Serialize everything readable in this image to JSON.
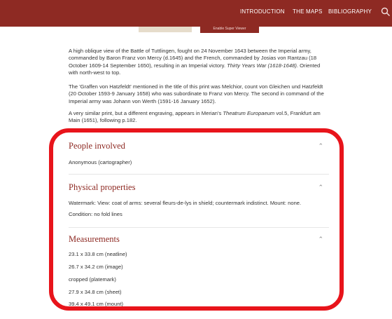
{
  "nav": {
    "introduction": "INTRODUCTION",
    "the_maps": "THE MAPS",
    "bibliography": "BIBLIOGRAPHY"
  },
  "fragments": {
    "button_text": "Enable Super Viewer"
  },
  "description": {
    "p1_before": "A high oblique view of the Battle of Tuttlingen, fought on 24 November 1643 between the Imperial army, commanded by Baron Franz von Mercy (d.1645) and the French, commanded by Josias von Rantzau (18 October 1609-14 September 1650), resulting in an Imperial victory. ",
    "p1_italic": "Thirty Years War (1618-1648)",
    "p1_after": ". Oriented with north-west to top.",
    "p2": "The 'Graffen von Hatzfeldt' mentioned in the title of this print was Melchior, count von Gleichen und Hatzfeldt (20 October 1593-9 January 1658) who was subordinate to Franz von Mercy. The second in command of the Imperial army was Johann von Werth (1591-16 January 1652).",
    "p3_before": "A very similar print, but a different engraving, appears in Merian's ",
    "p3_italic": "Theatrum Europaeum",
    "p3_after": " vol.5, Frankfurt am Main (1651), following p.182."
  },
  "sections": {
    "people": {
      "title": "People involved",
      "items": [
        "Anonymous (cartographer)"
      ]
    },
    "physical": {
      "title": "Physical properties",
      "items": [
        "Watermark: View: coat of arms: several fleurs-de-lys in shield; countermark indistinct. Mount: none.",
        "Condition: no fold lines"
      ]
    },
    "measurements": {
      "title": "Measurements",
      "items": [
        "23.1 x 33.8 cm (neatline)",
        "26.7 x 34.2 cm (image)",
        "cropped (platemark)",
        "27.9 x 34.8 cm (sheet)",
        "39.4 x 49.1 cm (mount)"
      ]
    }
  },
  "icons": {
    "search": "search-icon",
    "chevron": "chevron-up-icon"
  },
  "colors": {
    "brand": "#8e2a23",
    "highlight": "#e8141b"
  }
}
